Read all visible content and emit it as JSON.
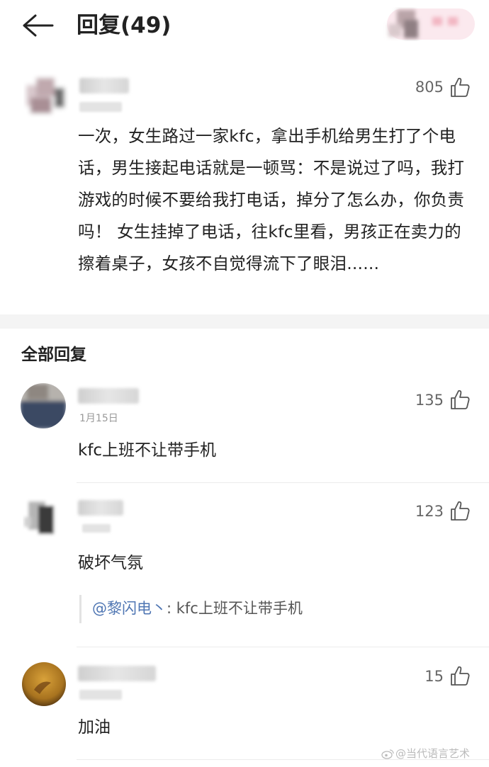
{
  "header": {
    "title": "回复(49)"
  },
  "main_comment": {
    "likes": "805",
    "text": "一次，女生路过一家kfc，拿出手机给男生打了个电话，男生接起电话就是一顿骂：不是说过了吗，我打游戏的时候不要给我打电话，掉分了怎么办，你负责吗！ 女生挂掉了电话，往kfc里看，男孩正在卖力的擦着桌子，女孩不自觉得流下了眼泪......"
  },
  "replies_section": {
    "title": "全部回复"
  },
  "replies": [
    {
      "likes": "135",
      "date": "1月15日",
      "text": "kfc上班不让带手机"
    },
    {
      "likes": "123",
      "text": "破坏气氛",
      "quote_name": "@黎闪电丶",
      "quote_text": ": kfc上班不让带手机"
    },
    {
      "likes": "15",
      "text": "加油"
    }
  ],
  "watermark": "@当代语言艺术"
}
